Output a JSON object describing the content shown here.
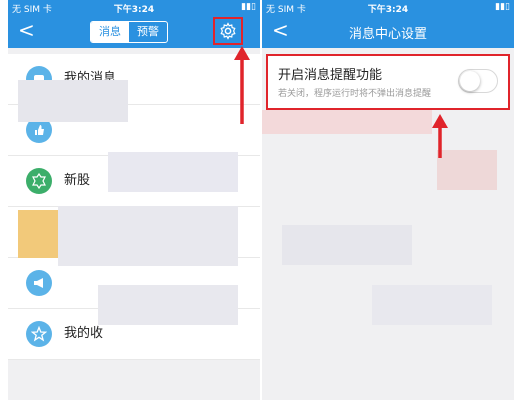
{
  "left": {
    "status": {
      "carrier": "无 SIM 卡",
      "time": "下午3:24"
    },
    "nav": {
      "tab_messages": "消息",
      "tab_alerts": "预警"
    },
    "items": [
      {
        "label": "我的消息",
        "icon": "message-icon",
        "color": "#5bb3e8"
      },
      {
        "label": "",
        "icon": "thumb-up-icon",
        "color": "#5bb3e8"
      },
      {
        "label": "新股",
        "icon": "new-icon",
        "color": "#3cae6a"
      },
      {
        "label": "",
        "icon": "folder-icon",
        "color": "#e8b94c"
      },
      {
        "label": "",
        "icon": "megaphone-icon",
        "color": "#5bb3e8"
      },
      {
        "label": "我的收",
        "icon": "star-icon",
        "color": "#5bb3e8"
      }
    ]
  },
  "right": {
    "status": {
      "carrier": "无 SIM 卡",
      "time": "下午3:24"
    },
    "nav": {
      "title": "消息中心设置"
    },
    "setting": {
      "title": "开启消息提醒功能",
      "desc": "若关闭，程序运行时将不弹出消息提醒",
      "enabled": false
    }
  },
  "colors": {
    "navbar": "#2a91e0",
    "highlight": "#e0242b"
  }
}
